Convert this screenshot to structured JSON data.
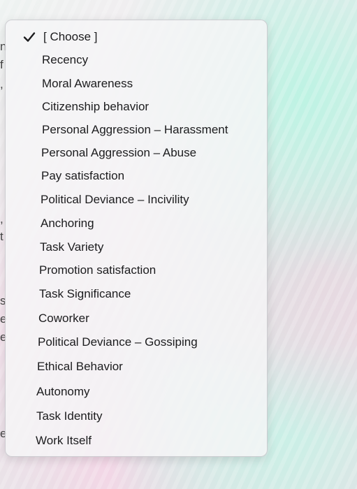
{
  "background_fragments": [
    "n",
    "f",
    ",",
    ",",
    "t",
    "s",
    "e",
    "e",
    "e"
  ],
  "dropdown": {
    "selected_index": 0,
    "items": [
      "[ Choose ]",
      "Recency",
      "Moral Awareness",
      "Citizenship behavior",
      "Personal Aggression – Harassment",
      "Personal Aggression – Abuse",
      "Pay satisfaction",
      "Political Deviance – Incivility",
      "Anchoring",
      "Task Variety",
      "Promotion satisfaction",
      "Task Significance",
      "Coworker",
      "Political Deviance – Gossiping",
      "Ethical Behavior",
      "Autonomy",
      "Task Identity",
      "Work Itself"
    ]
  },
  "icons": {
    "selected_marker": "checkmark-icon"
  },
  "colors": {
    "menu_text": "#1c1c1e",
    "menu_background": "#f5f5f7"
  }
}
